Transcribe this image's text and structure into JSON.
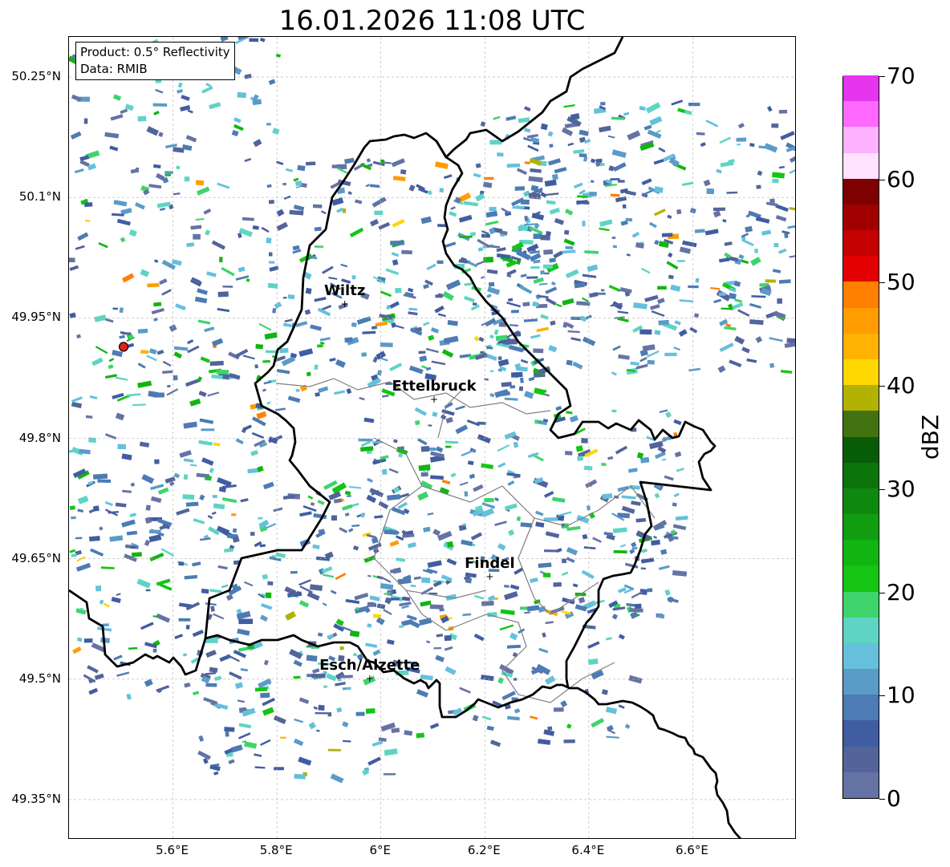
{
  "title": "16.01.2026 11:08 UTC",
  "info": {
    "product": "Product: 0.5° Reflectivity",
    "source": "Data: RMIB"
  },
  "map": {
    "lon_range": [
      5.4,
      6.8
    ],
    "lat_range": [
      49.3,
      50.3
    ],
    "lat_ticks": [
      {
        "value": 50.25,
        "label": "50.25°N"
      },
      {
        "value": 50.1,
        "label": "50.1°N"
      },
      {
        "value": 49.95,
        "label": "49.95°N"
      },
      {
        "value": 49.8,
        "label": "49.8°N"
      },
      {
        "value": 49.65,
        "label": "49.65°N"
      },
      {
        "value": 49.5,
        "label": "49.5°N"
      },
      {
        "value": 49.35,
        "label": "49.35°N"
      }
    ],
    "lon_ticks": [
      {
        "value": 5.6,
        "label": "5.6°E"
      },
      {
        "value": 5.8,
        "label": "5.8°E"
      },
      {
        "value": 6.0,
        "label": "6°E"
      },
      {
        "value": 6.2,
        "label": "6.2°E"
      },
      {
        "value": 6.4,
        "label": "6.4°E"
      },
      {
        "value": 6.6,
        "label": "6.6°E"
      }
    ],
    "radar_site": {
      "lon": 5.505,
      "lat": 49.914,
      "color": "#e02020"
    },
    "cities": [
      {
        "name": "Wiltz",
        "lon": 5.932,
        "lat": 49.966
      },
      {
        "name": "Ettelbruck",
        "lon": 6.104,
        "lat": 49.847
      },
      {
        "name": "Findel",
        "lon": 6.211,
        "lat": 49.627
      },
      {
        "name": "Esch/Alzette",
        "lon": 5.98,
        "lat": 49.5
      }
    ],
    "border_color": "#000000",
    "canton_color": "#808080"
  },
  "colorbar": {
    "label": "dBZ",
    "min": 0,
    "max": 70,
    "ticks": [
      {
        "value": 0,
        "label": "0"
      },
      {
        "value": 10,
        "label": "10"
      },
      {
        "value": 20,
        "label": "20"
      },
      {
        "value": 30,
        "label": "30"
      },
      {
        "value": 40,
        "label": "40"
      },
      {
        "value": 50,
        "label": "50"
      },
      {
        "value": 60,
        "label": "60"
      },
      {
        "value": 70,
        "label": "70"
      }
    ],
    "colors": [
      "#6573a4",
      "#53649a",
      "#415da2",
      "#4d7bb3",
      "#5a9bc8",
      "#65c0dc",
      "#5ed4c4",
      "#3ed46b",
      "#14c514",
      "#11b511",
      "#109e10",
      "#0f880f",
      "#0b740b",
      "#075c07",
      "#437311",
      "#b2b202",
      "#ffd700",
      "#ffb200",
      "#ff9c00",
      "#ff7f00",
      "#e20000",
      "#c40000",
      "#a00000",
      "#7f0000",
      "#ffe2ff",
      "#ffb2ff",
      "#ff69ff",
      "#e535ef"
    ]
  }
}
